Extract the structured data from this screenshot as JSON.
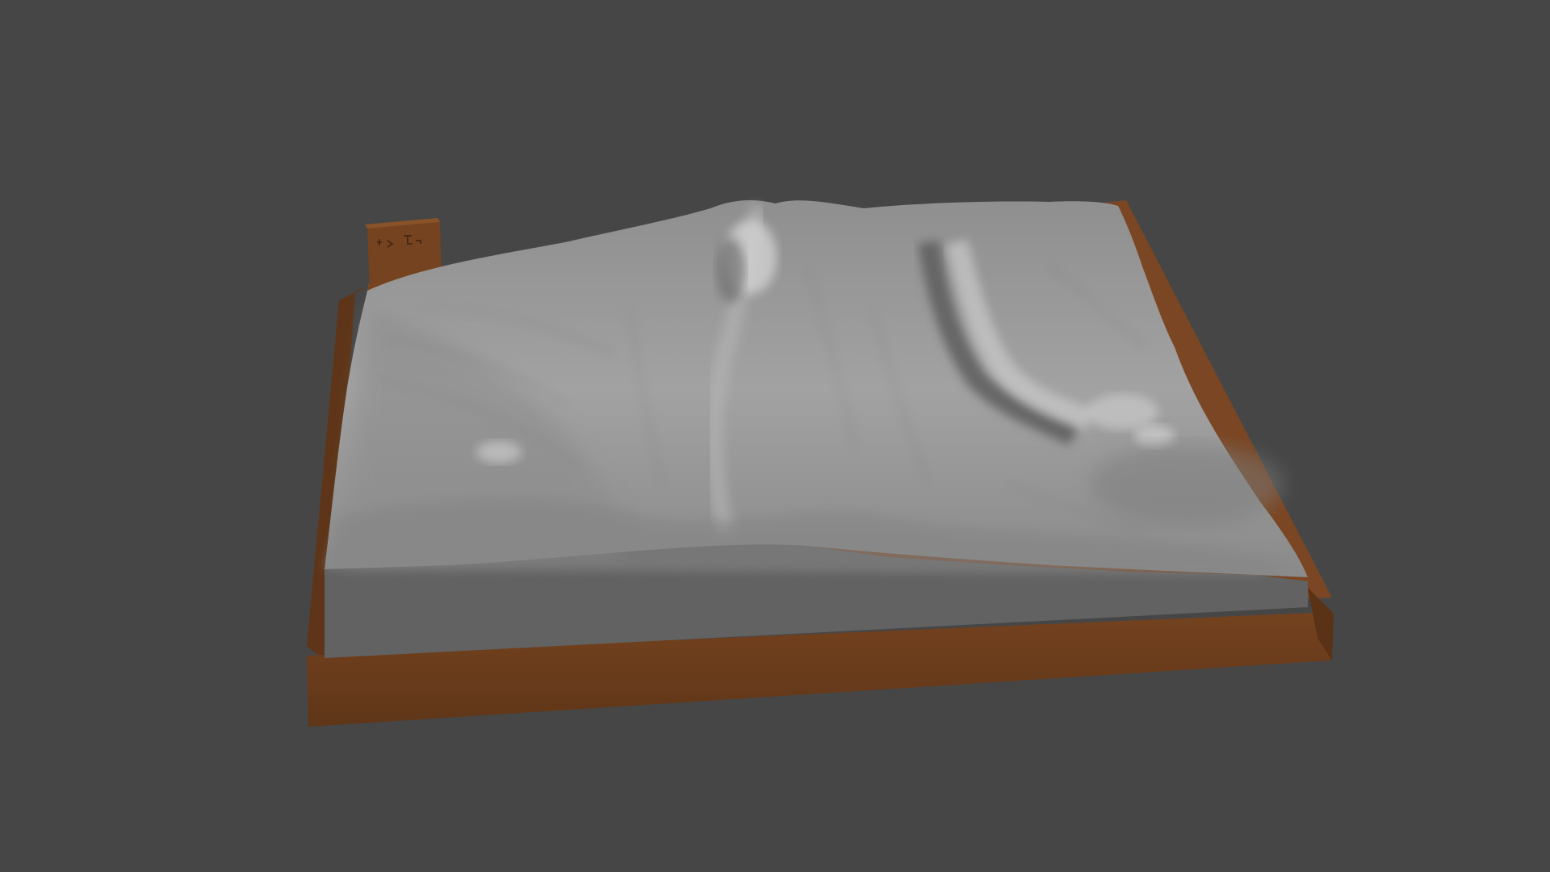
{
  "viewport": {
    "background_color": "#464646",
    "object": {
      "base_color": "#6b3e1f",
      "base_top_color": "#7e4a26",
      "terrain_color": "#9c9c9c",
      "terrain_highlight_color": "#c8c8c8",
      "terrain_shadow_color": "#767676",
      "side_wall_color": "#626262",
      "label_block_color": "#7a4623",
      "engraving_icon": "logo-engraving"
    }
  }
}
